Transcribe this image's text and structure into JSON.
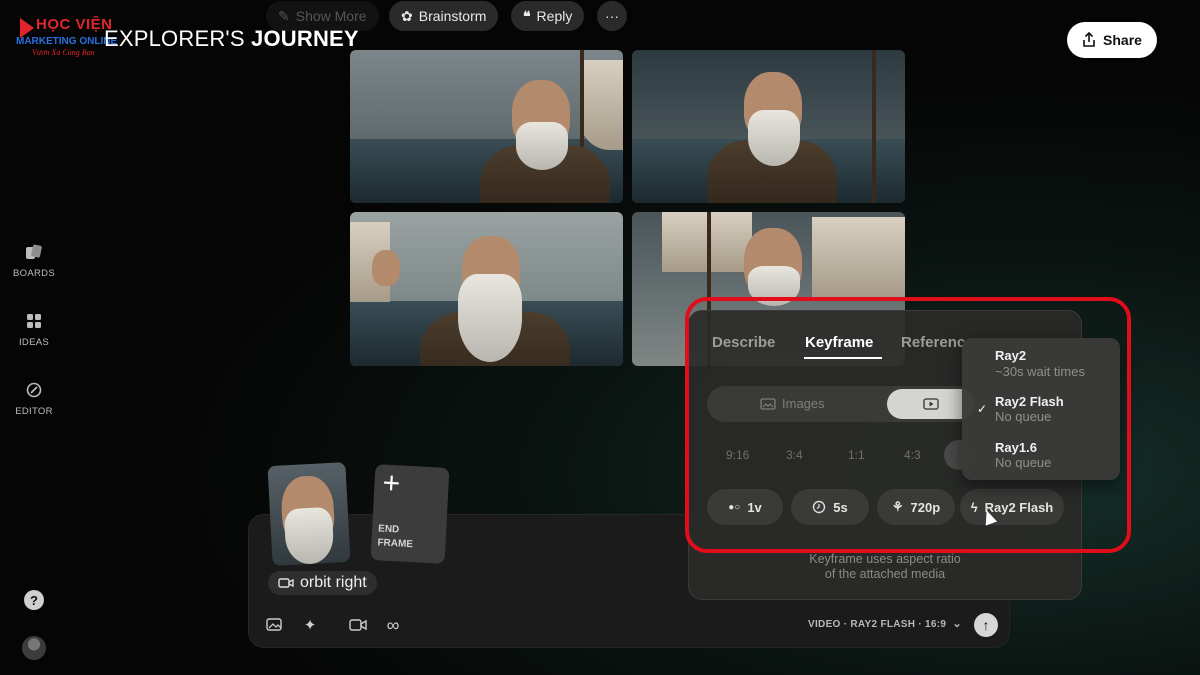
{
  "watermark": {
    "line1": "HỌC VIỆN",
    "line2": "MARKETING ONLINE",
    "line3": "Vươn Xa Cùng Bạn"
  },
  "header": {
    "title_part1": "EXPLORER'S ",
    "title_part2": "JOURNEY",
    "pills": [
      {
        "label": "Show More",
        "icon": "pencil-icon"
      },
      {
        "label": "Brainstorm",
        "icon": "brainstorm-icon"
      },
      {
        "label": "Reply",
        "icon": "quote-icon"
      }
    ],
    "more_label": "···",
    "share_label": "Share"
  },
  "sidebar": {
    "items": [
      {
        "label": "BOARDS",
        "icon": "boards-icon"
      },
      {
        "label": "IDEAS",
        "icon": "ideas-icon"
      },
      {
        "label": "EDITOR",
        "icon": "editor-icon"
      }
    ],
    "help_label": "?"
  },
  "composer": {
    "end_frame_plus": "+",
    "end_frame_label1": "END",
    "end_frame_label2": "FRAME",
    "camera_motion": "orbit right",
    "mode_label": "VIDEO · RAY2 FLASH · 16:9",
    "send_label": "↑"
  },
  "panel": {
    "tabs": [
      "Describe",
      "Keyframe",
      "Referenc"
    ],
    "active_tab": "Keyframe",
    "segment_left": "Images",
    "aspect_ratios": [
      "9:16",
      "3:4",
      "1:1",
      "4:3"
    ],
    "chips": {
      "loop": "1v",
      "duration": "5s",
      "resolution": "720p",
      "model": "Ray2 Flash"
    },
    "note_line1": "Keyframe uses aspect ratio",
    "note_line2": "of the attached media"
  },
  "model_dropdown": {
    "options": [
      {
        "name": "Ray2",
        "sub": "~30s wait times"
      },
      {
        "name": "Ray2 Flash",
        "sub": "No queue",
        "selected": true
      },
      {
        "name": "Ray1.6",
        "sub": "No queue"
      }
    ],
    "check_mark": "✓"
  },
  "colors": {
    "highlight": "#e10d1b",
    "accent_white": "#ffffff"
  }
}
